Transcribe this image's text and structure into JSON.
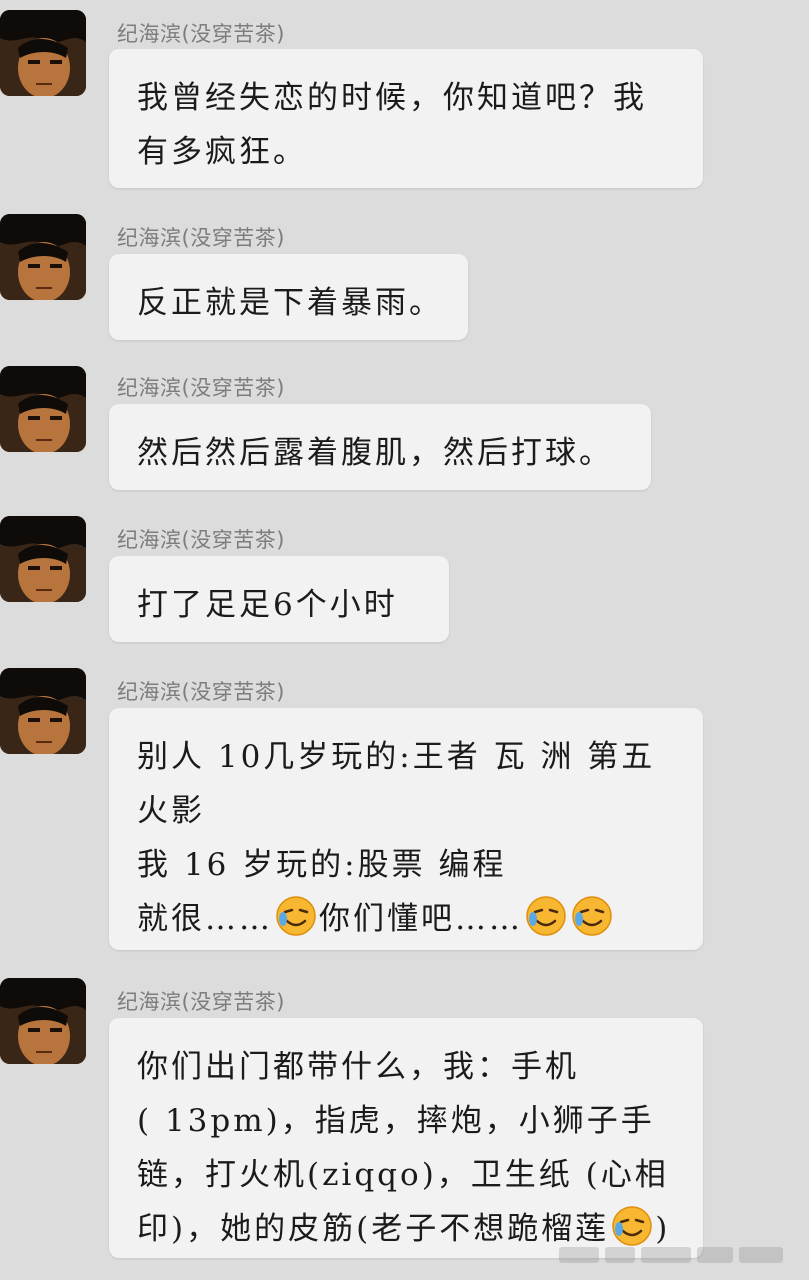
{
  "chat": {
    "sender_name": "纪海滨(没穿苦茶)",
    "messages": [
      {
        "lines": [
          "我曾经失恋的时候，你知道吧？我",
          "有多疯狂。"
        ]
      },
      {
        "lines": [
          "反正就是下着暴雨。"
        ]
      },
      {
        "lines": [
          "然后然后露着腹肌，然后打球。"
        ]
      },
      {
        "lines": [
          "打了足足6个小时"
        ]
      },
      {
        "lines": [
          "别人 10几岁玩的:王者 瓦 洲 第五",
          "火影",
          "我 16 岁玩的:股票 编程",
          "就很……",
          "你们懂吧……"
        ]
      },
      {
        "lines": [
          "你们出门都带什么，我：手机",
          "( 13pm)，指虎，摔炮，小狮子手",
          "链，打火机(ziqqo)，卫生纸 (心相",
          "印)，她的皮筋(老子不想跪榴莲",
          ")"
        ]
      }
    ]
  },
  "icons": {
    "emoji": "crying-laughing-emoji",
    "avatar": "anime-avatar"
  }
}
